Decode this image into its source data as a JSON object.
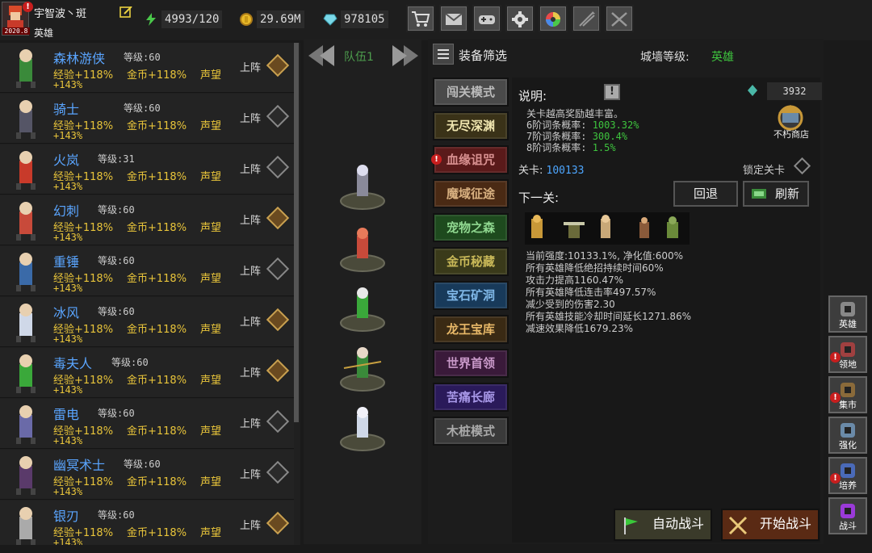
{
  "player": {
    "name": "宇智波丶斑",
    "rank": "英雄",
    "badge": "2020.8"
  },
  "resources": {
    "stamina": "4993/120",
    "gold": "29.69M",
    "gems": "978105"
  },
  "top_buttons": [
    "shop-icon",
    "mail-icon",
    "gamepad-icon",
    "gear-icon",
    "color-wheel-icon",
    "arrows-icon",
    "swords-icon"
  ],
  "heroes": [
    {
      "name": "森林游侠",
      "level": "等级:60",
      "exp": "经验+118%",
      "gold": "金币+118%",
      "rep": "声望",
      "exp2": "+143%",
      "deploy": "上阵",
      "on": true,
      "color": "#3a8a3a"
    },
    {
      "name": "骑士",
      "level": "等级:60",
      "exp": "经验+118%",
      "gold": "金币+118%",
      "rep": "声望",
      "exp2": "+143%",
      "deploy": "上阵",
      "on": false,
      "color": "#555566"
    },
    {
      "name": "火岚",
      "level": "等级:31",
      "exp": "经验+118%",
      "gold": "金币+118%",
      "rep": "声望",
      "exp2": "+143%",
      "deploy": "上阵",
      "on": false,
      "color": "#c83a2a"
    },
    {
      "name": "幻刺",
      "level": "等级:60",
      "exp": "经验+118%",
      "gold": "金币+118%",
      "rep": "声望",
      "exp2": "+143%",
      "deploy": "上阵",
      "on": true,
      "color": "#c84a3a"
    },
    {
      "name": "重锤",
      "level": "等级:60",
      "exp": "经验+118%",
      "gold": "金币+118%",
      "rep": "声望",
      "exp2": "+143%",
      "deploy": "上阵",
      "on": false,
      "color": "#3a6aa8"
    },
    {
      "name": "冰风",
      "level": "等级:60",
      "exp": "经验+118%",
      "gold": "金币+118%",
      "rep": "声望",
      "exp2": "+143%",
      "deploy": "上阵",
      "on": true,
      "color": "#cfd8e8"
    },
    {
      "name": "毒夫人",
      "level": "等级:60",
      "exp": "经验+118%",
      "gold": "金币+118%",
      "rep": "声望",
      "exp2": "+143%",
      "deploy": "上阵",
      "on": true,
      "color": "#3aa83a"
    },
    {
      "name": "雷电",
      "level": "等级:60",
      "exp": "经验+118%",
      "gold": "金币+118%",
      "rep": "声望",
      "exp2": "+143%",
      "deploy": "上阵",
      "on": false,
      "color": "#6a6aa8"
    },
    {
      "name": "幽冥术士",
      "level": "等级:60",
      "exp": "经验+118%",
      "gold": "金币+118%",
      "rep": "声望",
      "exp2": "+143%",
      "deploy": "上阵",
      "on": false,
      "color": "#5a3a6a"
    },
    {
      "name": "银刃",
      "level": "等级:60",
      "exp": "经验+118%",
      "gold": "金币+118%",
      "rep": "声望",
      "exp2": "+143%",
      "deploy": "上阵",
      "on": true,
      "color": "#aaaaaa"
    }
  ],
  "team": {
    "name": "队伍1"
  },
  "filter": {
    "label": "装备筛选"
  },
  "wall": {
    "label": "城墙等级:",
    "value": "英雄"
  },
  "modes": [
    {
      "label": "闯关模式",
      "bg": "#4a4a4a",
      "fg": "#bbbbbb"
    },
    {
      "label": "无尽深渊",
      "bg": "#3a3218",
      "fg": "#f0e6b0"
    },
    {
      "label": "血缘诅咒",
      "bg": "#5a1a1a",
      "fg": "#d89090",
      "alert": true
    },
    {
      "label": "魔域征途",
      "bg": "#4a2a14",
      "fg": "#d8b080"
    },
    {
      "label": "宠物之森",
      "bg": "#1e4a1e",
      "fg": "#90d890"
    },
    {
      "label": "金币秘藏",
      "bg": "#3a3a1a",
      "fg": "#c8b858"
    },
    {
      "label": "宝石矿洞",
      "bg": "#183a5a",
      "fg": "#80b8e8"
    },
    {
      "label": "龙王宝库",
      "bg": "#3a2a14",
      "fg": "#e8b868"
    },
    {
      "label": "世界首领",
      "bg": "#3a1a3a",
      "fg": "#c898c8"
    },
    {
      "label": "苦痛长廊",
      "bg": "#2a1a5a",
      "fg": "#a898e8"
    },
    {
      "label": "木桩模式",
      "bg": "#3a3a3a",
      "fg": "#aaaaaa"
    }
  ],
  "info": {
    "desc_label": "说明:",
    "gem_count": "3932",
    "shop_label": "不朽商店",
    "line1": "关卡越高奖励越丰富。",
    "probs": [
      {
        "label": "6阶词条概率:",
        "value": "1003.32%"
      },
      {
        "label": "7阶词条概率:",
        "value": "300.4%"
      },
      {
        "label": "8阶词条概率:",
        "value": "1.5%"
      }
    ],
    "stage_label": "关卡:",
    "stage_value": "100133",
    "lock_label": "锁定关卡",
    "next_label": "下一关:",
    "back_label": "回退",
    "refresh_label": "刷新",
    "stats": [
      "当前强度:10133.1%, 净化值:600%",
      "所有英雄降低绝招持续时间60%",
      "攻击力提高1160.47%",
      "所有英雄降低连击率497.57%",
      "减少受到的伤害2.30",
      "所有英雄技能冷却时间延长1271.86%",
      "减速效果降低1679.23%"
    ]
  },
  "side_buttons": [
    {
      "label": "英雄",
      "icon": "helmet-icon",
      "color": "#888888"
    },
    {
      "label": "领地",
      "icon": "castle-icon",
      "color": "#a04040",
      "alert": true
    },
    {
      "label": "集市",
      "icon": "market-icon",
      "color": "#8a6a3a",
      "alert": true
    },
    {
      "label": "强化",
      "icon": "anvil-icon",
      "color": "#6a8aa8"
    },
    {
      "label": "培养",
      "icon": "statue-icon",
      "color": "#4a6ab8",
      "alert": true
    },
    {
      "label": "战斗",
      "icon": "portal-icon",
      "color": "#9a3ad8"
    }
  ],
  "auto_battle": "自动战斗",
  "start_battle": "开始战斗"
}
